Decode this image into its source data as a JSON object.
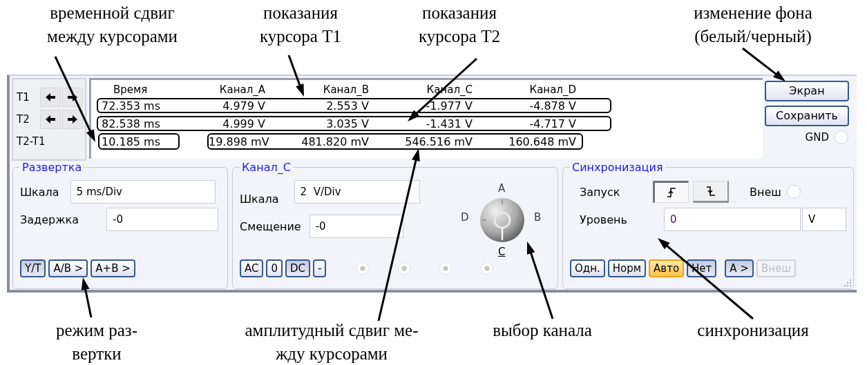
{
  "callouts_top": [
    {
      "lines": [
        "временной сдвиг",
        "между курсорами"
      ]
    },
    {
      "lines": [
        "показания",
        "курсора T1"
      ]
    },
    {
      "lines": [
        "показания",
        "курсора T2"
      ]
    },
    {
      "lines": [
        "изменение фона",
        "(белый/черный)"
      ]
    }
  ],
  "panel": {
    "cursors": [
      {
        "label": "T1",
        "has_arrows": true
      },
      {
        "label": "T2",
        "has_arrows": true
      },
      {
        "label": "T2-T1",
        "has_arrows": false
      }
    ],
    "readings": {
      "columns": [
        "Время",
        "Канал_A",
        "Канал_B",
        "Канал_C",
        "Канал_D"
      ],
      "rows": [
        {
          "time": "72.353 ms",
          "values": [
            "4.979 V",
            "2.553 V",
            "-1.977 V",
            "-4.878 V"
          ],
          "framed": true,
          "time_framed": false,
          "values_framed": false
        },
        {
          "time": "82.538 ms",
          "values": [
            "4.999 V",
            "3.035 V",
            "-1.431 V",
            "-4.717 V"
          ],
          "framed": true,
          "time_framed": false,
          "values_framed": false
        },
        {
          "time": "10.185 ms",
          "values": [
            "19.898 mV",
            "481.820 mV",
            "546.516 mV",
            "160.648 mV"
          ],
          "framed": false,
          "time_framed": true,
          "values_framed": true
        }
      ]
    },
    "side_buttons": [
      {
        "label": "Экран"
      },
      {
        "label": "Сохранить"
      }
    ],
    "gnd": {
      "label": "GND",
      "checked": false
    },
    "timebase": {
      "title": "Развертка",
      "fields": [
        {
          "label": "Шкала",
          "value": "5 ms/Div"
        },
        {
          "label": "Задержка",
          "value": "-0"
        }
      ],
      "buttons": [
        {
          "label": "Y/T",
          "pressed": true
        },
        {
          "label": "A/B >",
          "pressed": false
        },
        {
          "label": "A+B >",
          "pressed": false
        }
      ]
    },
    "channel": {
      "title": "Канал_C",
      "fields": [
        {
          "label": "Шкала",
          "value": "2  V/Div"
        },
        {
          "label": "Смещение",
          "value": "-0"
        }
      ],
      "buttons": [
        {
          "label": "AC",
          "pressed": false
        },
        {
          "label": "0",
          "pressed": false
        },
        {
          "label": "DC",
          "pressed": true
        },
        {
          "label": "-",
          "pressed": false
        }
      ],
      "radios": [
        {
          "disabled": true
        },
        {
          "disabled": true
        },
        {
          "disabled": true
        },
        {
          "disabled": true
        }
      ],
      "selector": [
        {
          "label": "A",
          "selected": false
        },
        {
          "label": "B",
          "selected": false
        },
        {
          "label": "C",
          "selected": true
        },
        {
          "label": "D",
          "selected": false
        }
      ]
    },
    "trigger": {
      "title": "Синхронизация",
      "edge_label": "Запуск",
      "edges": [
        {
          "kind": "rising",
          "selected": true
        },
        {
          "kind": "falling",
          "selected": false
        }
      ],
      "ext": {
        "label": "Внеш",
        "checked": false
      },
      "level": {
        "label": "Уровень",
        "value": "0",
        "unit": "V"
      },
      "buttons": [
        {
          "label": "Одн.",
          "pressed": false,
          "highlighted": false,
          "disabled": false
        },
        {
          "label": "Норм",
          "pressed": false,
          "highlighted": false,
          "disabled": false
        },
        {
          "label": "Авто",
          "pressed": false,
          "highlighted": true,
          "disabled": false
        },
        {
          "label": "Нет",
          "pressed": true,
          "highlighted": false,
          "disabled": false
        },
        {
          "label": "A >",
          "pressed": true,
          "highlighted": false,
          "disabled": false
        },
        {
          "label": "Внеш",
          "pressed": false,
          "highlighted": false,
          "disabled": true
        }
      ]
    }
  },
  "callouts_bottom": [
    {
      "lines": [
        "режим раз-",
        "вертки"
      ]
    },
    {
      "lines": [
        "амплитудный сдвиг ме-",
        "жду курсорами"
      ]
    },
    {
      "lines": [
        "выбор канала"
      ]
    },
    {
      "lines": [
        "синхронизация"
      ]
    }
  ]
}
